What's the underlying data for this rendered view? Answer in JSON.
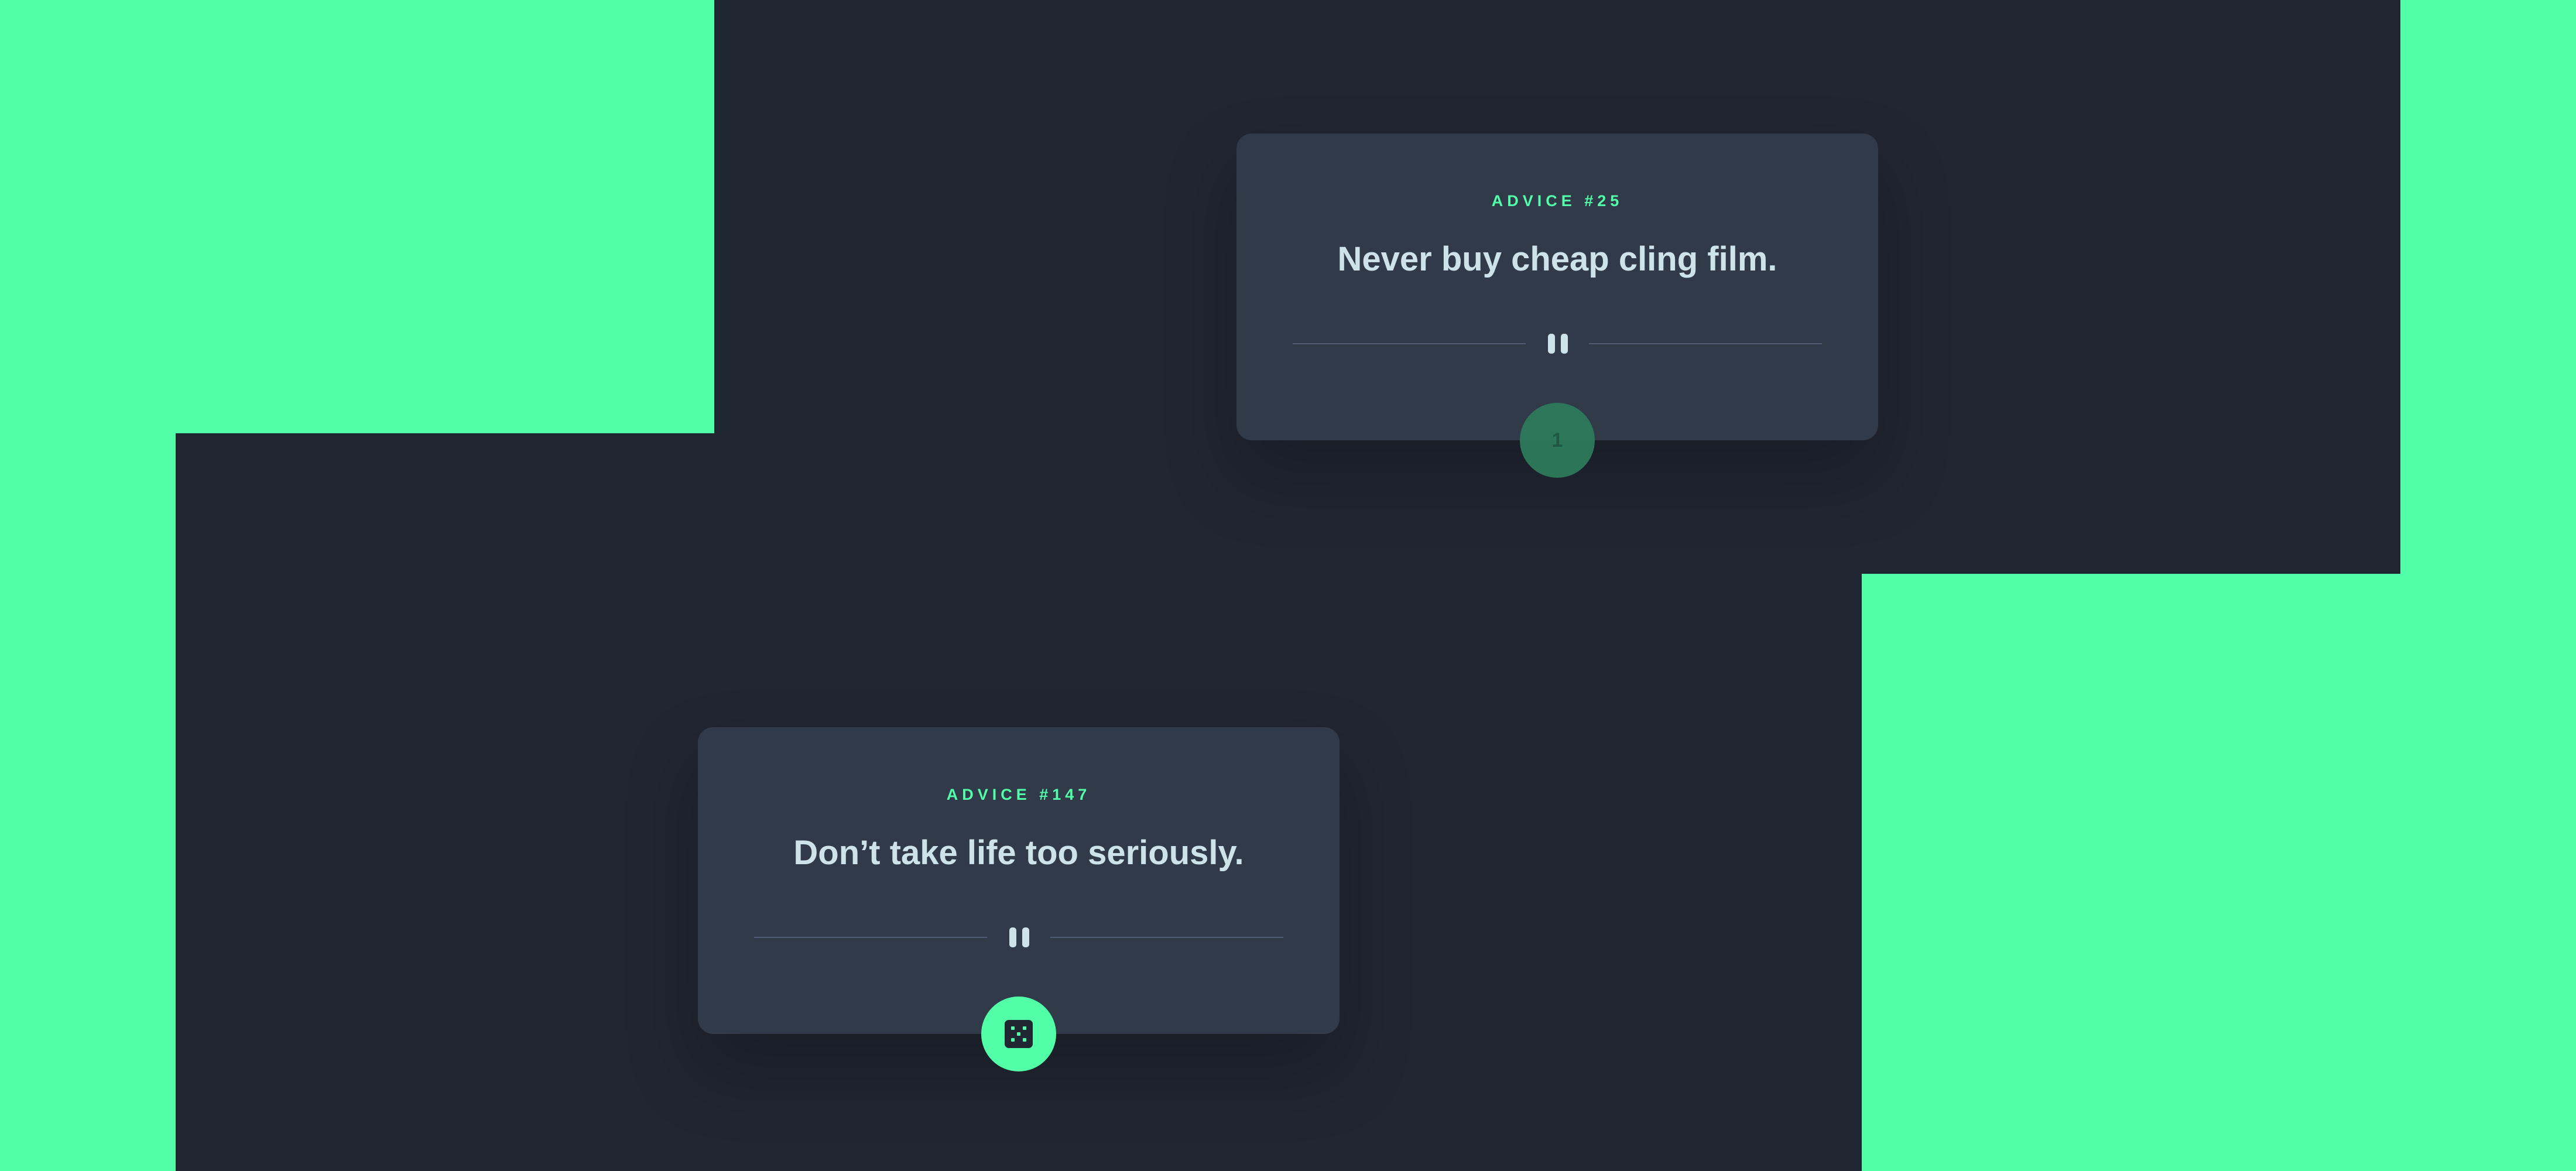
{
  "cards": [
    {
      "label": "ADVICE #25",
      "advice": "Never buy cheap cling film.",
      "button": {
        "state": "loading",
        "text": "1",
        "icon": "dice-icon"
      }
    },
    {
      "label": "ADVICE #147",
      "advice": "Don’t take life too seriously.",
      "button": {
        "state": "ready",
        "icon": "dice-icon"
      }
    }
  ],
  "colors": {
    "accent": "#52ffa8",
    "card_bg": "#313a48",
    "panel_bg": "#202632",
    "text": "#cee3e9",
    "divider": "#4f5d74"
  }
}
